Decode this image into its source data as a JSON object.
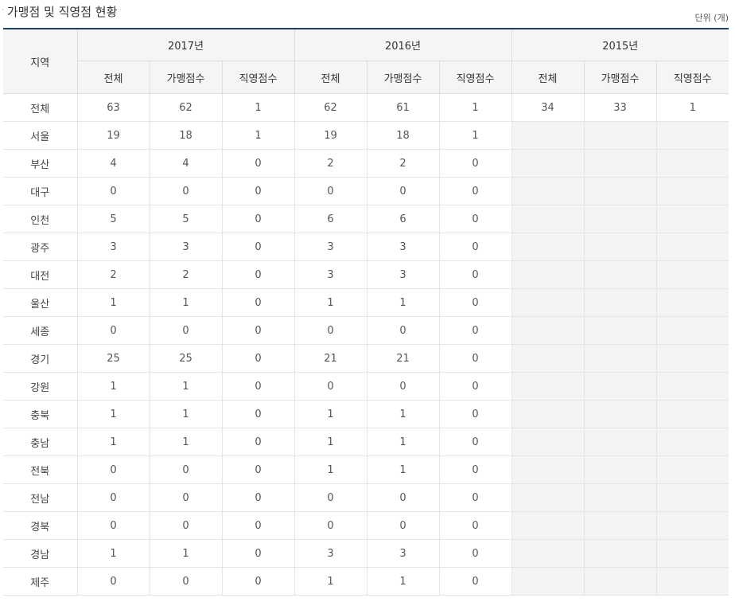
{
  "title": {
    "bullet": "·",
    "text": "가맹점 및 직영점 현황"
  },
  "unit": "단위 (개)",
  "table": {
    "region_header": "지역",
    "years": [
      "2017년",
      "2016년",
      "2015년"
    ],
    "sub_headers": [
      "전체",
      "가맹점수",
      "직영점수"
    ],
    "rows": [
      {
        "region": "전체",
        "values": [
          "63",
          "62",
          "1",
          "62",
          "61",
          "1",
          "34",
          "33",
          "1"
        ]
      },
      {
        "region": "서울",
        "values": [
          "19",
          "18",
          "1",
          "19",
          "18",
          "1",
          "",
          "",
          ""
        ]
      },
      {
        "region": "부산",
        "values": [
          "4",
          "4",
          "0",
          "2",
          "2",
          "0",
          "",
          "",
          ""
        ]
      },
      {
        "region": "대구",
        "values": [
          "0",
          "0",
          "0",
          "0",
          "0",
          "0",
          "",
          "",
          ""
        ]
      },
      {
        "region": "인천",
        "values": [
          "5",
          "5",
          "0",
          "6",
          "6",
          "0",
          "",
          "",
          ""
        ]
      },
      {
        "region": "광주",
        "values": [
          "3",
          "3",
          "0",
          "3",
          "3",
          "0",
          "",
          "",
          ""
        ]
      },
      {
        "region": "대전",
        "values": [
          "2",
          "2",
          "0",
          "3",
          "3",
          "0",
          "",
          "",
          ""
        ]
      },
      {
        "region": "울산",
        "values": [
          "1",
          "1",
          "0",
          "1",
          "1",
          "0",
          "",
          "",
          ""
        ]
      },
      {
        "region": "세종",
        "values": [
          "0",
          "0",
          "0",
          "0",
          "0",
          "0",
          "",
          "",
          ""
        ]
      },
      {
        "region": "경기",
        "values": [
          "25",
          "25",
          "0",
          "21",
          "21",
          "0",
          "",
          "",
          ""
        ]
      },
      {
        "region": "강원",
        "values": [
          "1",
          "1",
          "0",
          "0",
          "0",
          "0",
          "",
          "",
          ""
        ]
      },
      {
        "region": "충북",
        "values": [
          "1",
          "1",
          "0",
          "1",
          "1",
          "0",
          "",
          "",
          ""
        ]
      },
      {
        "region": "충남",
        "values": [
          "1",
          "1",
          "0",
          "1",
          "1",
          "0",
          "",
          "",
          ""
        ]
      },
      {
        "region": "전북",
        "values": [
          "0",
          "0",
          "0",
          "1",
          "1",
          "0",
          "",
          "",
          ""
        ]
      },
      {
        "region": "전남",
        "values": [
          "0",
          "0",
          "0",
          "0",
          "0",
          "0",
          "",
          "",
          ""
        ]
      },
      {
        "region": "경북",
        "values": [
          "0",
          "0",
          "0",
          "0",
          "0",
          "0",
          "",
          "",
          ""
        ]
      },
      {
        "region": "경남",
        "values": [
          "1",
          "1",
          "0",
          "3",
          "3",
          "0",
          "",
          "",
          ""
        ]
      },
      {
        "region": "제주",
        "values": [
          "0",
          "0",
          "0",
          "1",
          "1",
          "0",
          "",
          "",
          ""
        ]
      }
    ]
  }
}
